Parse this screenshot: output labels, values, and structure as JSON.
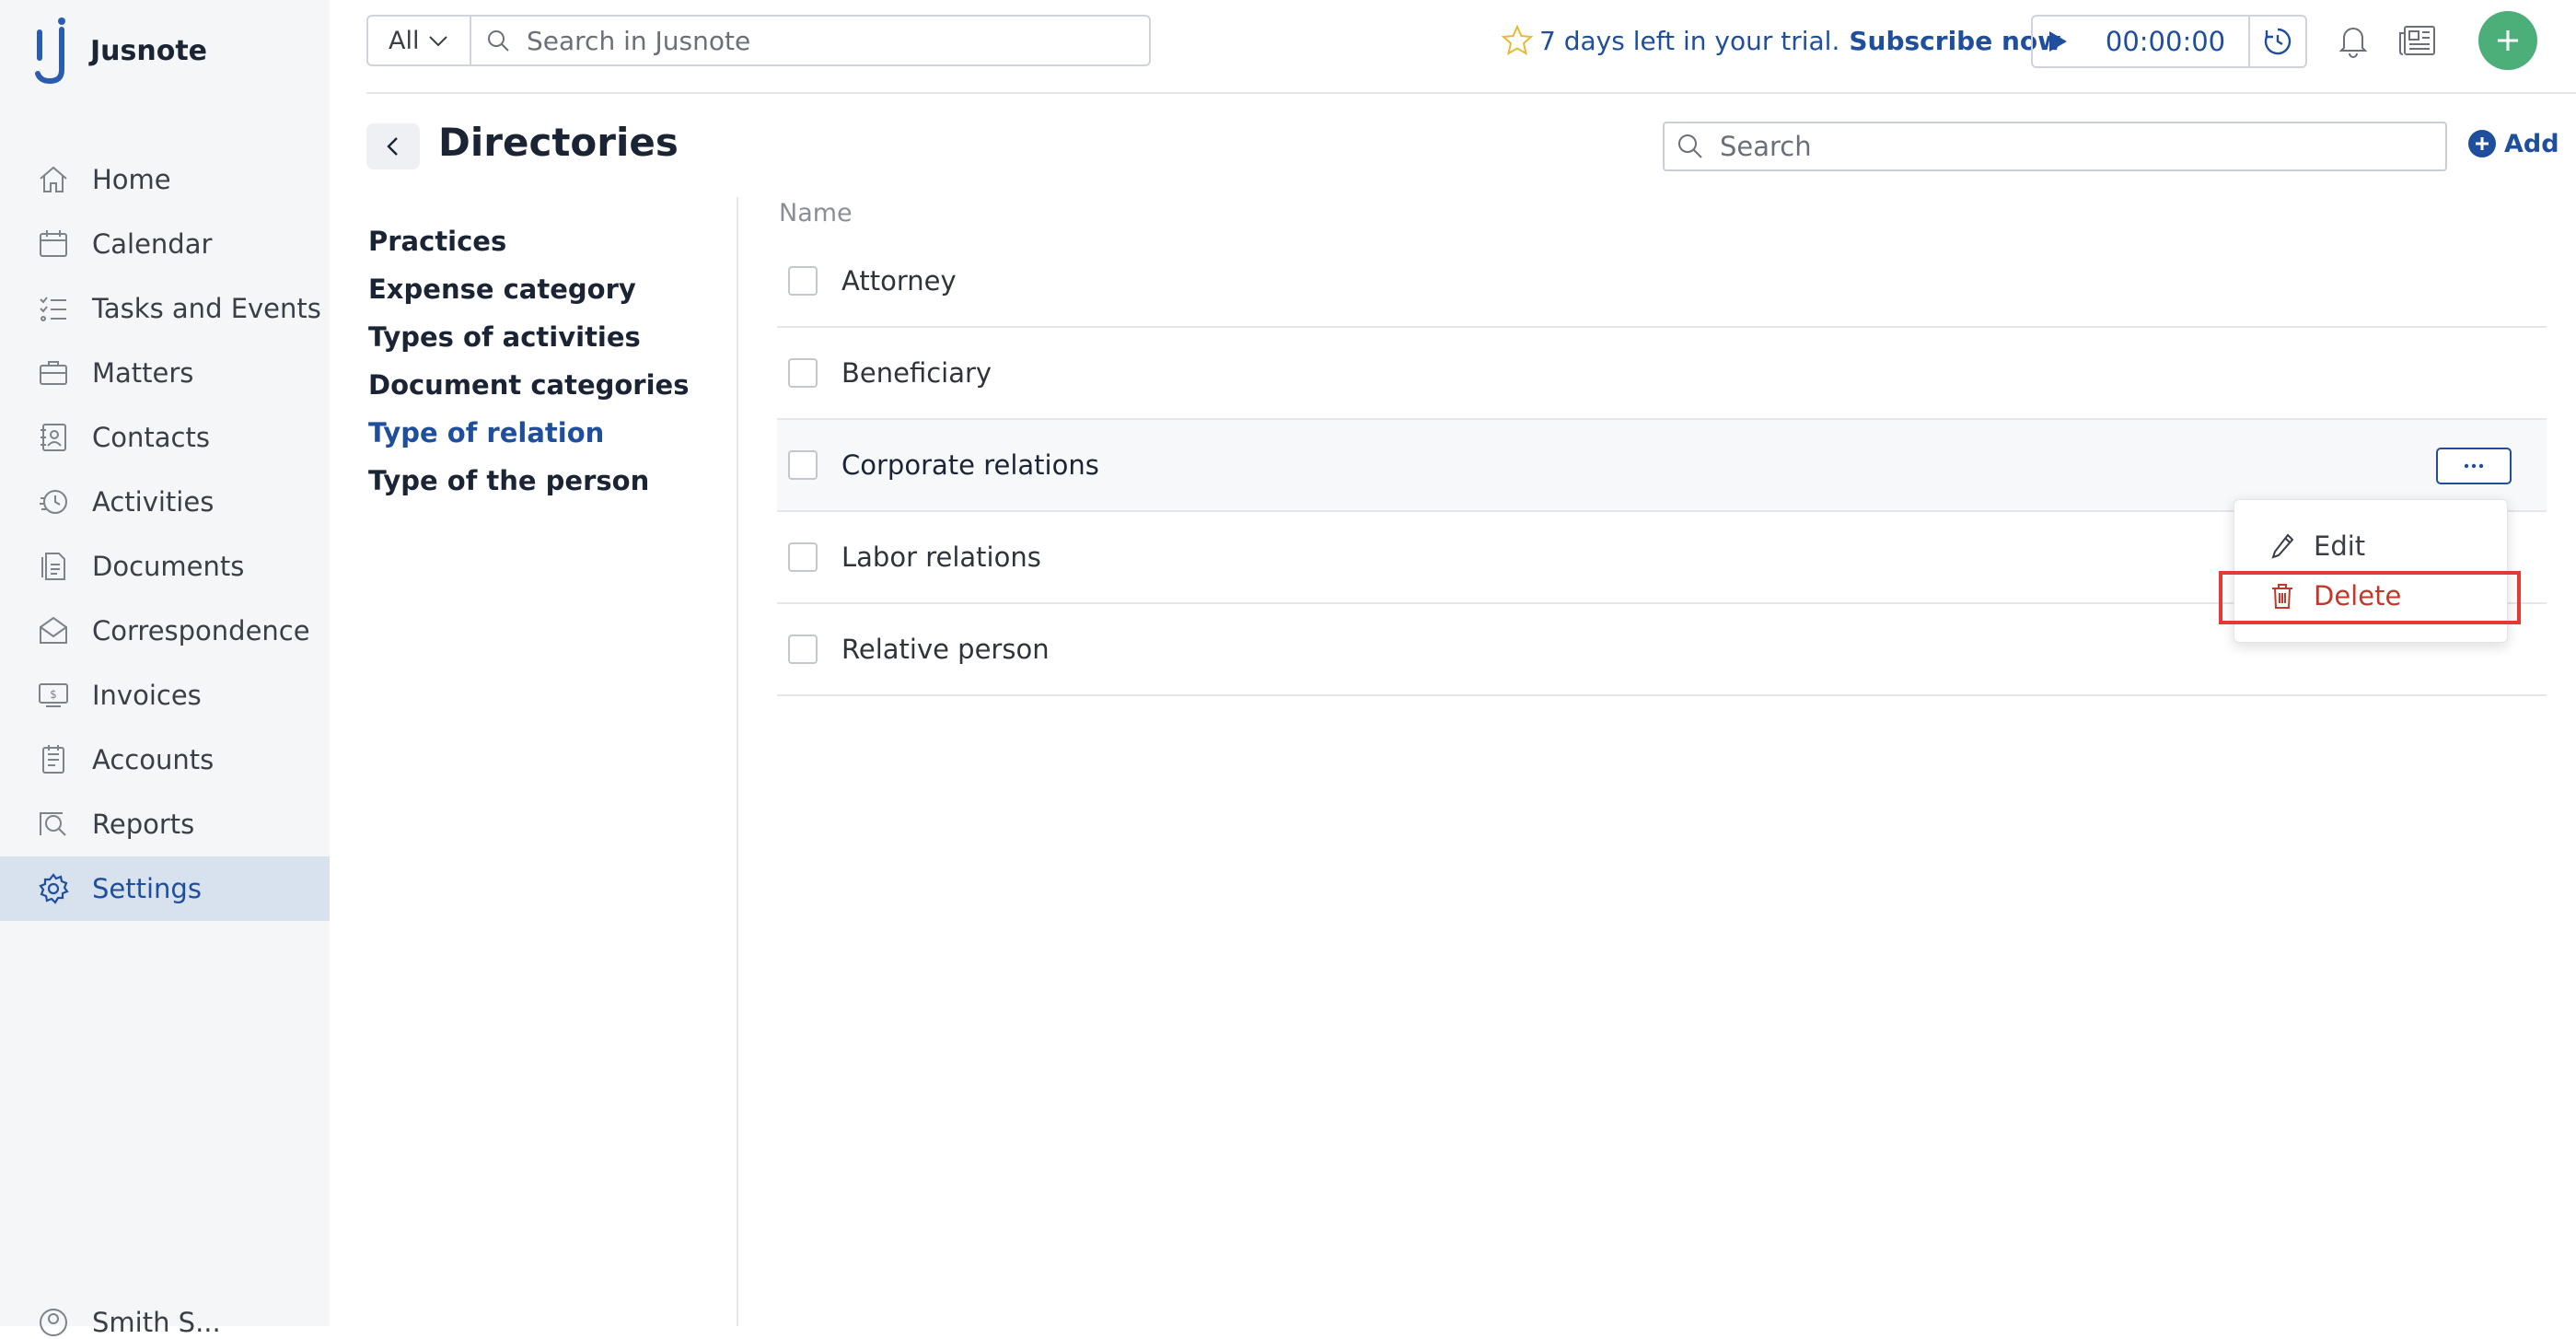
{
  "app": {
    "name": "Jusnote"
  },
  "sidebar": {
    "items": [
      {
        "id": "home",
        "label": "Home",
        "icon": "home-icon"
      },
      {
        "id": "calendar",
        "label": "Calendar",
        "icon": "calendar-icon"
      },
      {
        "id": "tasks",
        "label": "Tasks and Events",
        "icon": "tasks-icon"
      },
      {
        "id": "matters",
        "label": "Matters",
        "icon": "briefcase-icon"
      },
      {
        "id": "contacts",
        "label": "Contacts",
        "icon": "address-book-icon"
      },
      {
        "id": "activities",
        "label": "Activities",
        "icon": "clock-history-icon"
      },
      {
        "id": "documents",
        "label": "Documents",
        "icon": "documents-icon"
      },
      {
        "id": "correspondence",
        "label": "Correspondence",
        "icon": "envelope-icon"
      },
      {
        "id": "invoices",
        "label": "Invoices",
        "icon": "invoice-icon"
      },
      {
        "id": "accounts",
        "label": "Accounts",
        "icon": "ledger-icon"
      },
      {
        "id": "reports",
        "label": "Reports",
        "icon": "report-icon"
      },
      {
        "id": "settings",
        "label": "Settings",
        "icon": "gear-icon",
        "active": true
      }
    ],
    "user_label": "Smith S..."
  },
  "topbar": {
    "scope_label": "All",
    "search_placeholder": "Search in Jusnote",
    "trial_text": "7 days left in your trial.",
    "subscribe_label": "Subscribe now",
    "timer_value": "00:00:00"
  },
  "page": {
    "title": "Directories",
    "search_placeholder": "Search",
    "add_label": "Add"
  },
  "subnav": {
    "items": [
      {
        "label": "Practices"
      },
      {
        "label": "Expense category"
      },
      {
        "label": "Types of activities"
      },
      {
        "label": "Document categories"
      },
      {
        "label": "Type of relation",
        "active": true
      },
      {
        "label": "Type of the person"
      }
    ]
  },
  "list": {
    "column_name": "Name",
    "rows": [
      {
        "label": "Attorney"
      },
      {
        "label": "Beneficiary"
      },
      {
        "label": "Corporate relations",
        "hover": true
      },
      {
        "label": "Labor relations"
      },
      {
        "label": "Relative person"
      }
    ]
  },
  "menu": {
    "edit_label": "Edit",
    "delete_label": "Delete"
  },
  "colors": {
    "accent": "#1f4f9c",
    "danger": "#c0392b",
    "highlight": "#e53935",
    "fab": "#4caf7a"
  }
}
